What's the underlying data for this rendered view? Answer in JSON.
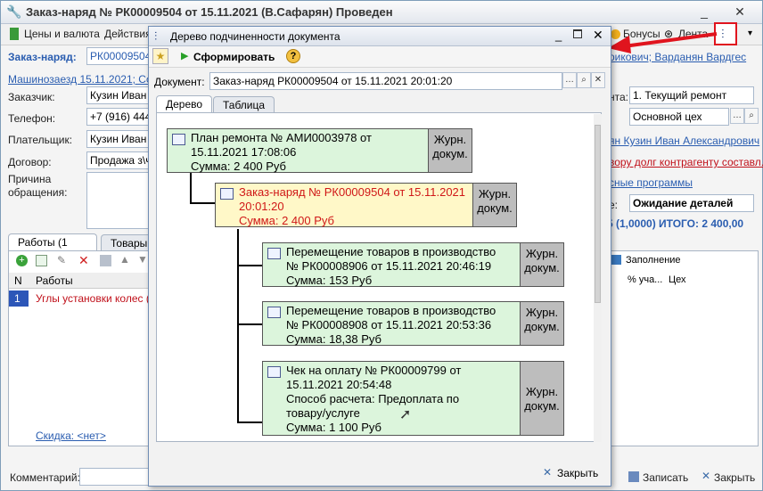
{
  "main": {
    "title": "Заказ-наряд № РК00009504 от 15.11.2021 (В.Сафарян) Проведен",
    "toolbar": {
      "prices": "Цены и валюта",
      "actions": "Действия",
      "bonuses": "Бонусы",
      "tape": "Лента"
    },
    "doc_label": "Заказ-наряд:",
    "doc_value": "РК00009504",
    "link_base": "Машинозаезд 15.11.2021; Созд",
    "customer_label": "Заказчик:",
    "customer_value": "Кузин Иван А",
    "phone_label": "Телефон:",
    "phone_value": "+7 (916) 4445",
    "payer_label": "Плательщик:",
    "payer_value": "Кузин Иван А",
    "contract_label": "Договор:",
    "contract_value": "Продажа з\\ч",
    "reason_label": "Причина обращения:",
    "tabs": [
      "Работы (1 поз.)",
      "Товары"
    ],
    "table_head": [
      "N",
      "Работы"
    ],
    "table_row": {
      "n": "1",
      "name": "Углы установки колес (2"
    },
    "discount": "Скидка: <нет>",
    "comment_label": "Комментарий:",
    "right": {
      "employee": "рикович; Варданян Вардгес",
      "type_label": "нта:",
      "type_value": "1. Текущий ремонт",
      "shop_value": "Основной цех",
      "contact": "ян Кузин Иван Александрович",
      "debt": "вору долг контрагенту составл...",
      "programs": "сные программы",
      "status_label": "е:",
      "status_value": "Ожидание деталей",
      "total": "5 (1,0000) ИТОГО: 2 400,00",
      "fill": "Заполнение",
      "col1": "% уча...",
      "col2": "Цех",
      "save": "Записать",
      "close": "Закрыть"
    }
  },
  "dialog": {
    "title": "Дерево подчиненности документа",
    "generate": "Сформировать",
    "doc_label": "Документ:",
    "doc_value": "Заказ-наряд РК00009504 от 15.11.2021 20:01:20",
    "tabs": [
      "Дерево",
      "Таблица"
    ],
    "jr": "Журн. докум.",
    "nodes": [
      {
        "lines": [
          "План ремонта № АМИ0003978 от",
          "15.11.2021 17:08:06",
          "Сумма: 2 400 Руб"
        ]
      },
      {
        "lines": [
          "Заказ-наряд № РК00009504 от 15.11.2021",
          "20:01:20",
          "Сумма: 2 400 Руб"
        ]
      },
      {
        "lines": [
          "Перемещение товаров в производство",
          "№ РК00008906 от 15.11.2021 20:46:19",
          "Сумма: 153 Руб"
        ]
      },
      {
        "lines": [
          "Перемещение товаров в производство",
          "№ РК00008908 от 15.11.2021 20:53:36",
          "Сумма: 18,38 Руб"
        ]
      },
      {
        "lines": [
          "Чек на оплату № РК00009799 от",
          "15.11.2021 20:54:48",
          "Способ расчета: Предоплата по",
          "товару/услуге",
          "Сумма: 1 100 Руб"
        ]
      }
    ],
    "close": "Закрыть"
  },
  "accent": "#e0141e"
}
